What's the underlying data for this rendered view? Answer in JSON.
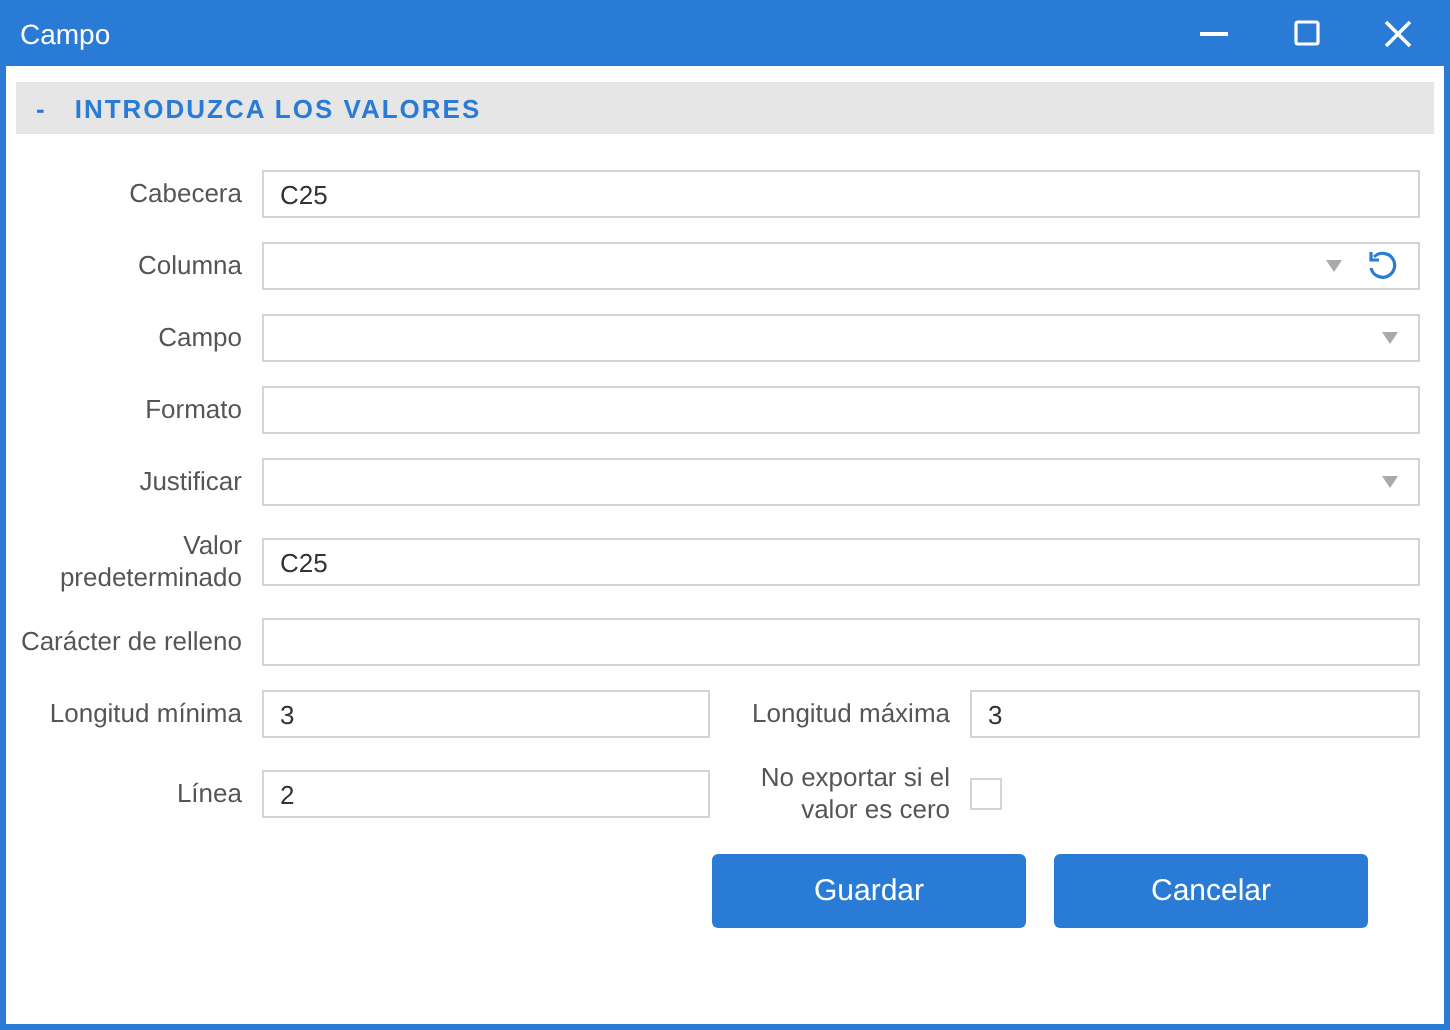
{
  "window": {
    "title": "Campo"
  },
  "section": {
    "toggle": "-",
    "title": "INTRODUZCA LOS VALORES",
    "expanded": true
  },
  "rows": [
    {
      "fields": [
        {
          "label": "Cabecera",
          "kind": "text",
          "value": "C25"
        }
      ]
    },
    {
      "fields": [
        {
          "label": "Columna",
          "kind": "select_reset"
        }
      ]
    },
    {
      "fields": [
        {
          "label": "Campo",
          "kind": "select"
        }
      ]
    },
    {
      "fields": [
        {
          "label": "Formato",
          "kind": "text"
        }
      ]
    },
    {
      "fields": [
        {
          "label": "Justificar",
          "kind": "select"
        }
      ]
    },
    {
      "fields": [
        {
          "label": "Valor predeterminado",
          "kind": "text",
          "value": "C25"
        }
      ]
    },
    {
      "fields": [
        {
          "label": "Carácter de relleno",
          "kind": "text"
        }
      ]
    },
    {
      "fields": [
        {
          "label": "Longitud mínima",
          "kind": "text",
          "value": "3"
        },
        {
          "label": "Longitud máxima",
          "kind": "text",
          "value": "3"
        }
      ]
    },
    {
      "fields": [
        {
          "label": "Línea",
          "kind": "text",
          "value": "2"
        },
        {
          "label": "No exportar si el valor es cero",
          "kind": "checkbox",
          "checked": false
        }
      ]
    }
  ],
  "buttons": [
    "Guardar",
    "Cancelar"
  ]
}
